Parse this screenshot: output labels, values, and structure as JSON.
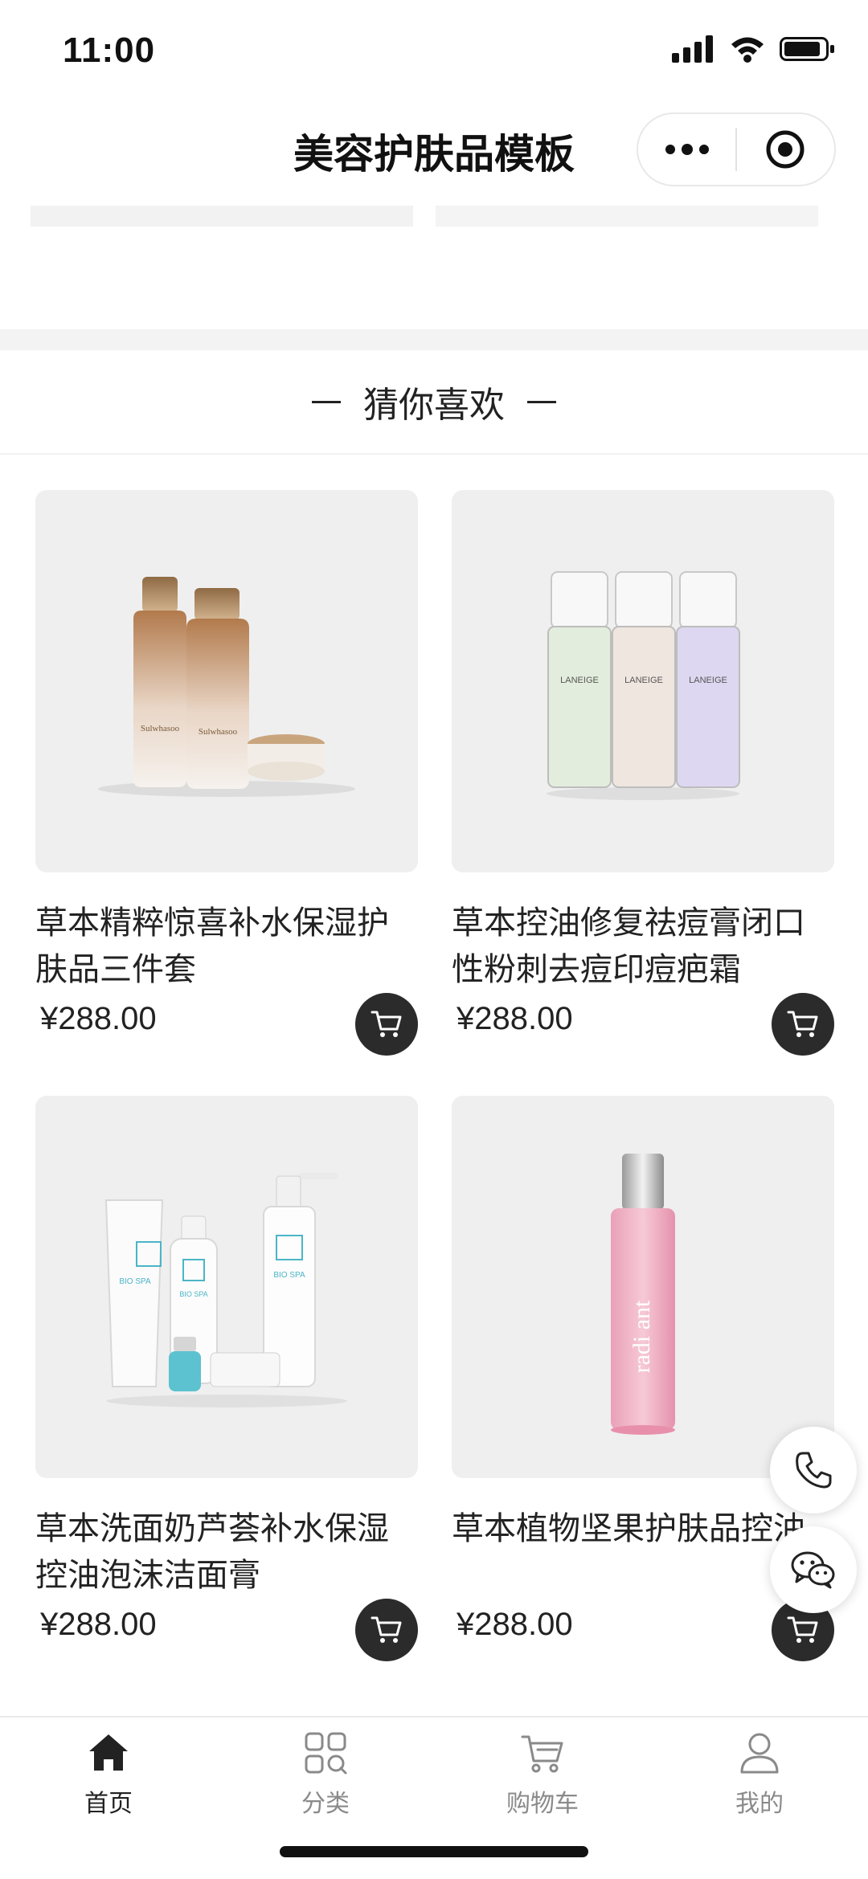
{
  "status_bar": {
    "time": "11:00"
  },
  "nav": {
    "title": "美容护肤品模板"
  },
  "section": {
    "title": "猜你喜欢"
  },
  "products": [
    {
      "name": "草本精粹惊喜补水保湿护肤品三件套",
      "price": "¥288.00",
      "image": "sulwhasoo-set"
    },
    {
      "name": "草本控油修复祛痘膏闭口性粉刺去痘印痘疤霜",
      "price": "¥288.00",
      "image": "laneige-bottles"
    },
    {
      "name": "草本洗面奶芦荟补水保湿控油泡沫洁面膏",
      "price": "¥288.00",
      "image": "bio-spa-set"
    },
    {
      "name": "草本植物坚果护肤品控油",
      "price": "¥288.00",
      "image": "radiant-bottle"
    }
  ],
  "floating": {
    "phone_icon": "phone-icon",
    "wechat_icon": "wechat-icon"
  },
  "tabs": [
    {
      "label": "首页",
      "icon": "home-icon",
      "active": true
    },
    {
      "label": "分类",
      "icon": "category-icon",
      "active": false
    },
    {
      "label": "购物车",
      "icon": "cart-icon",
      "active": false
    },
    {
      "label": "我的",
      "icon": "user-icon",
      "active": false
    }
  ],
  "colors": {
    "accent": "#2b2b2b",
    "muted": "#8a8a8a",
    "card_bg": "#efefef"
  }
}
